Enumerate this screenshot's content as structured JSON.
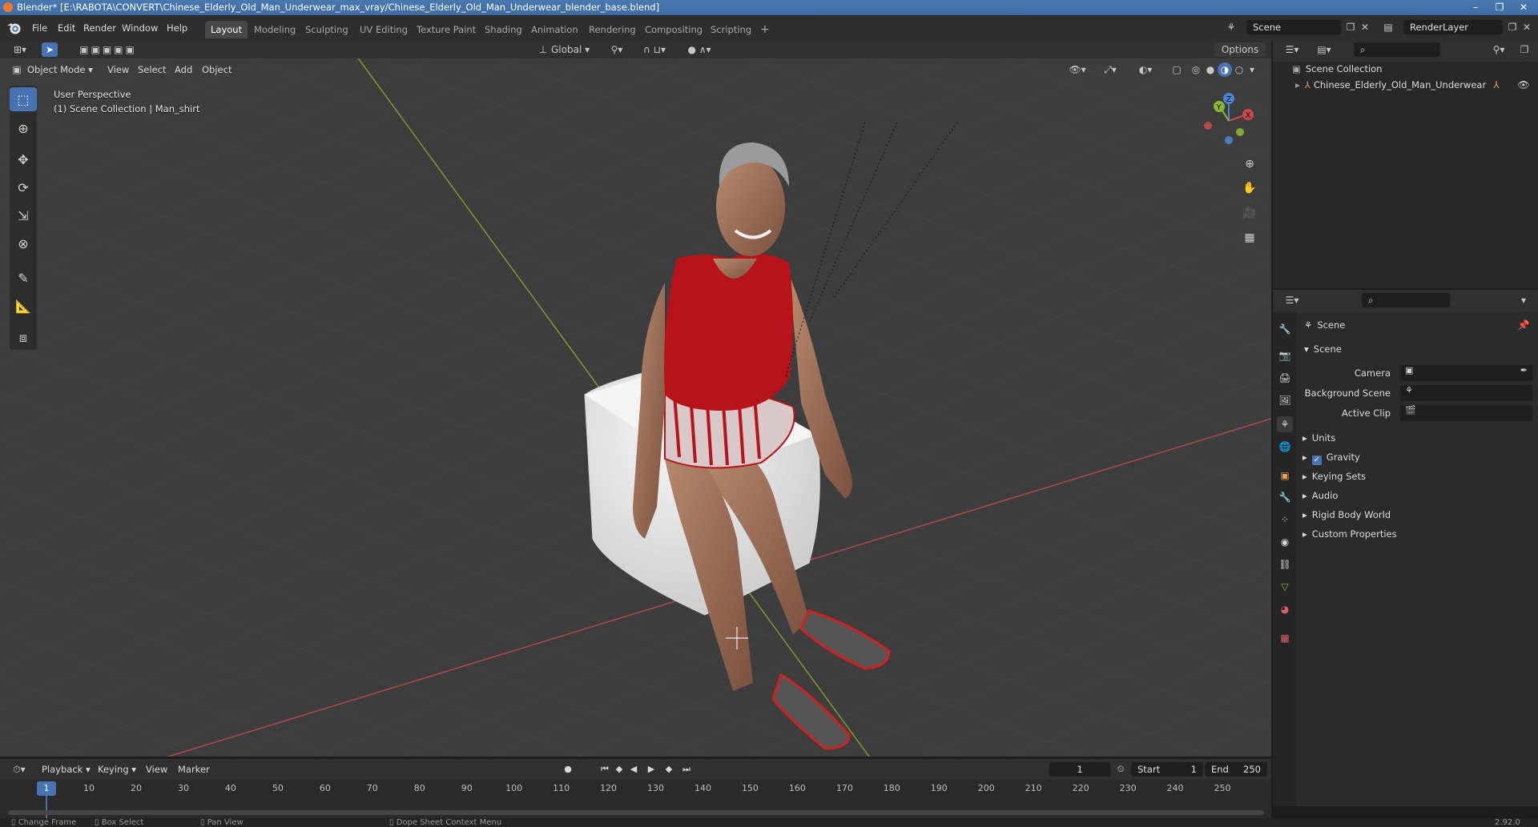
{
  "window": {
    "title": "Blender* [E:\\RABOTA\\CONVERT\\Chinese_Elderly_Old_Man_Underwear_max_vray/Chinese_Elderly_Old_Man_Underwear_blender_base.blend]",
    "minimize": "–",
    "maximize": "❐",
    "close": "✕"
  },
  "menu": {
    "items": [
      "File",
      "Edit",
      "Render",
      "Window",
      "Help"
    ]
  },
  "workspaces": {
    "tabs": [
      "Layout",
      "Modeling",
      "Sculpting",
      "UV Editing",
      "Texture Paint",
      "Shading",
      "Animation",
      "Rendering",
      "Compositing",
      "Scripting"
    ],
    "active": "Layout",
    "add": "+"
  },
  "scene_selector": {
    "scene": "Scene",
    "view_layer": "RenderLayer"
  },
  "header_tools": {
    "transform_orientation": "Global",
    "options": "Options"
  },
  "viewport_header": {
    "mode": "Object Mode",
    "menus": [
      "View",
      "Select",
      "Add",
      "Object"
    ]
  },
  "viewport": {
    "perspective": "User Perspective",
    "collection_info": "(1) Scene Collection | Man_shirt",
    "gizmo": {
      "x": "X",
      "y": "Y",
      "z": "Z"
    }
  },
  "outliner": {
    "root": "Scene Collection",
    "items": [
      "Chinese_Elderly_Old_Man_Underwear"
    ]
  },
  "properties": {
    "context": "Scene",
    "panel": "Scene",
    "fields": [
      {
        "label": "Camera",
        "value": ""
      },
      {
        "label": "Background Scene",
        "value": ""
      },
      {
        "label": "Active Clip",
        "value": ""
      }
    ],
    "subpanels": [
      "Units",
      "Gravity",
      "Keying Sets",
      "Audio",
      "Rigid Body World",
      "Custom Properties"
    ],
    "gravity_enabled": true
  },
  "timeline": {
    "menus": [
      "Playback",
      "Keying",
      "View",
      "Marker"
    ],
    "current_frame": "1",
    "start_label": "Start",
    "start": "1",
    "end_label": "End",
    "end": "250",
    "ticks": [
      "1",
      "10",
      "20",
      "30",
      "40",
      "50",
      "60",
      "70",
      "80",
      "90",
      "100",
      "110",
      "120",
      "130",
      "140",
      "150",
      "160",
      "170",
      "180",
      "190",
      "200",
      "210",
      "220",
      "230",
      "240",
      "250"
    ]
  },
  "status_bar": {
    "items": [
      "Change Frame",
      "Box Select",
      "Pan View",
      "Dope Sheet Context Menu"
    ],
    "version": "2.92.0"
  },
  "colors": {
    "accent": "#4772b3",
    "viewport_bg": "#3c3c3c",
    "x_axis": "#c84a4a",
    "y_axis": "#8ab832",
    "shirt": "#b8121a"
  }
}
